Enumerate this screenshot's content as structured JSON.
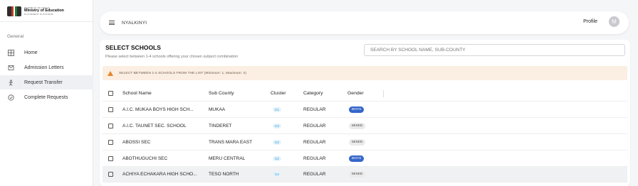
{
  "logo": {
    "line1": "REPUBLIC OF KENYA",
    "line2": "Ministry of Education",
    "line3": "PLACEMENT PLATFORM"
  },
  "sidebar": {
    "section": "General",
    "items": [
      {
        "label": "Home",
        "icon": "home-icon"
      },
      {
        "label": "Admission Letters",
        "icon": "letter-icon"
      },
      {
        "label": "Request Transfer",
        "icon": "transfer-icon",
        "active": true
      },
      {
        "label": "Complete Requests",
        "icon": "check-requests-icon"
      }
    ]
  },
  "topbar": {
    "school_name": "NYALKINYI",
    "profile_label": "Profile",
    "avatar_initial": "M"
  },
  "card": {
    "title": "SELECT SCHOOLS",
    "subtitle": "Please select between 1-4 schools offering your chosen subject combination",
    "search_placeholder": "SEARCH BY SCHOOL NAME, SUB-COUNTY",
    "alert": "SELECT BETWEEN 1-4 SCHOOLS FROM THE LIST (Minimum: 1, Maximum: 4)"
  },
  "table": {
    "headers": {
      "name": "School Name",
      "sub_county": "Sub County",
      "cluster": "Cluster",
      "category": "Category",
      "gender": "Gender"
    },
    "rows": [
      {
        "name": "A.I.C. MUKAA BOYS HIGH SCH...",
        "sub_county": "MUKAA",
        "cluster": "C1",
        "category": "REGULAR",
        "gender": "BOYS"
      },
      {
        "name": "A.I.C. TAUNET SEC. SCHOOL",
        "sub_county": "TINDERET",
        "cluster": "C3",
        "category": "REGULAR",
        "gender": "MIXED"
      },
      {
        "name": "ABOSSI SEC",
        "sub_county": "TRANS MARA EAST",
        "cluster": "C2",
        "category": "REGULAR",
        "gender": "MIXED"
      },
      {
        "name": "ABOTHUGUCHI SEC",
        "sub_county": "MERU CENTRAL",
        "cluster": "C2",
        "category": "REGULAR",
        "gender": "BOYS"
      },
      {
        "name": "ACHIYA ECHAKARA HIGH SCHO...",
        "sub_county": "TESO NORTH",
        "cluster": "C4",
        "category": "REGULAR",
        "gender": "MIXED"
      }
    ]
  },
  "colors": {
    "accent_blue": "#3566c9",
    "alert_bg": "#fbeee2",
    "warning": "#e8862a",
    "cluster": "#2c8fc9"
  }
}
